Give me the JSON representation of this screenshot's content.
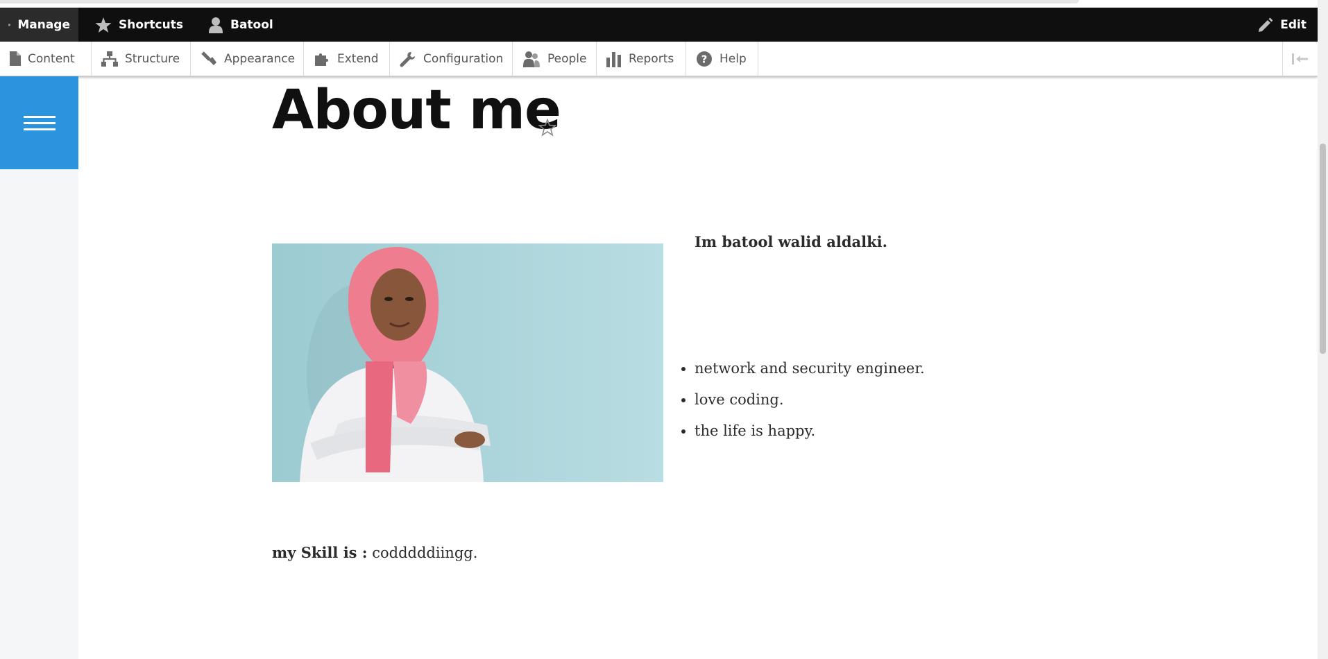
{
  "toolbar": {
    "manage_label": "Manage",
    "shortcuts_label": "Shortcuts",
    "user_label": "Batool",
    "edit_label": "Edit"
  },
  "tray": {
    "items": [
      {
        "label": "Content",
        "icon": "file-icon"
      },
      {
        "label": "Structure",
        "icon": "sitemap-icon"
      },
      {
        "label": "Appearance",
        "icon": "paintbrush-icon"
      },
      {
        "label": "Extend",
        "icon": "puzzle-icon"
      },
      {
        "label": "Configuration",
        "icon": "wrench-icon"
      },
      {
        "label": "People",
        "icon": "people-icon"
      },
      {
        "label": "Reports",
        "icon": "bar-chart-icon"
      },
      {
        "label": "Help",
        "icon": "help-icon"
      }
    ]
  },
  "page": {
    "title": "About me",
    "intro": "Im batool walid aldalki.",
    "facts": [
      "network and security engineer.",
      "love coding.",
      "the life is happy."
    ],
    "skill_label": "my Skill is :",
    "skill_value": " codddddiingg."
  },
  "colors": {
    "admin_bar": "#0f0f0f",
    "accent_blue": "#2b94de",
    "photo_background": "#a9d3d9",
    "hijab_pink": "#ee7d90"
  }
}
